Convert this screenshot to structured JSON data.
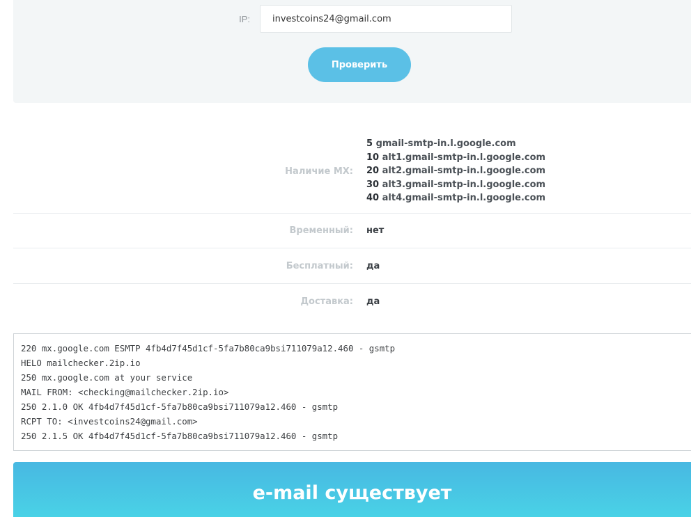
{
  "form": {
    "ip_label": "IP:",
    "email_value": "investcoins24@gmail.com",
    "check_button": "Проверить"
  },
  "results": {
    "mx_label": "Наличие MX:",
    "mx_records": [
      {
        "priority": "5",
        "host": "gmail-smtp-in.l.google.com"
      },
      {
        "priority": "10",
        "host": "alt1.gmail-smtp-in.l.google.com"
      },
      {
        "priority": "20",
        "host": "alt2.gmail-smtp-in.l.google.com"
      },
      {
        "priority": "30",
        "host": "alt3.gmail-smtp-in.l.google.com"
      },
      {
        "priority": "40",
        "host": "alt4.gmail-smtp-in.l.google.com"
      }
    ],
    "temporary_label": "Временный:",
    "temporary_value": "нет",
    "free_label": "Бесплатный:",
    "free_value": "да",
    "delivery_label": "Доставка:",
    "delivery_value": "да"
  },
  "smtp_log": [
    "220 mx.google.com ESMTP 4fb4d7f45d1cf-5fa7b80ca9bsi711079a12.460 - gsmtp",
    "HELO mailchecker.2ip.io",
    "250 mx.google.com at your service",
    "MAIL FROM: <checking@mailchecker.2ip.io>",
    "250 2.1.0 OK 4fb4d7f45d1cf-5fa7b80ca9bsi711079a12.460 - gsmtp",
    "RCPT TO: <investcoins24@gmail.com>",
    "250 2.1.5 OK 4fb4d7f45d1cf-5fa7b80ca9bsi711079a12.460 - gsmtp"
  ],
  "result_banner": "e-mail существует"
}
